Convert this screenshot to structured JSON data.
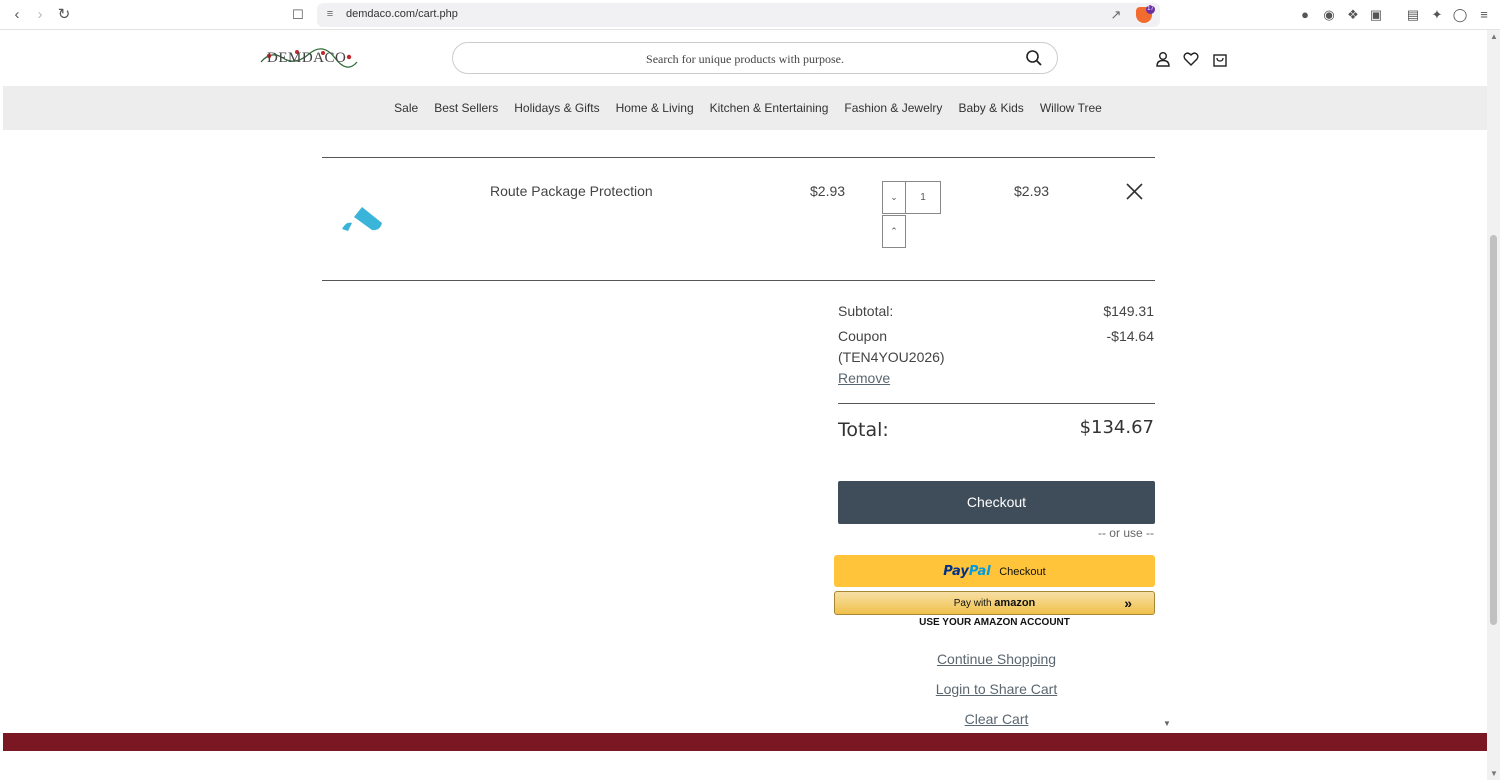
{
  "browser": {
    "url": "demdaco.com/cart.php",
    "brave_badge": "17"
  },
  "header": {
    "logo_text": "DEMDACO",
    "search_placeholder": "Search for unique products with purpose."
  },
  "category_nav": [
    "Sale",
    "Best Sellers",
    "Holidays & Gifts",
    "Home & Living",
    "Kitchen & Entertaining",
    "Fashion & Jewelry",
    "Baby & Kids",
    "Willow Tree"
  ],
  "cart_item": {
    "name": "Route Package Protection",
    "unit_price": "$2.93",
    "quantity": "1",
    "line_total": "$2.93",
    "logo_color": "#3ab4d8"
  },
  "summary": {
    "subtotal_label": "Subtotal:",
    "subtotal_value": "$149.31",
    "coupon_label": "Coupon",
    "coupon_code": "(TEN4YOU2026)",
    "coupon_value": "-$14.64",
    "remove_label": "Remove",
    "total_label": "Total:",
    "total_value": "$134.67"
  },
  "actions": {
    "checkout": "Checkout",
    "or_use": "-- or use --",
    "paypal_pay": "Pay",
    "paypal_pal": "Pal",
    "paypal_checkout": "Checkout",
    "amazon_pay_with": "Pay with",
    "amazon_word": "amazon",
    "amazon_caption": "USE YOUR AMAZON ACCOUNT",
    "continue_shopping": "Continue Shopping",
    "login_share": "Login to Share Cart",
    "clear_cart": "Clear Cart"
  },
  "colors": {
    "checkout_bg": "#3f4d5a",
    "footer_band": "#7b1722",
    "paypal_bg": "#ffc439",
    "nav_bg": "#ededed"
  }
}
